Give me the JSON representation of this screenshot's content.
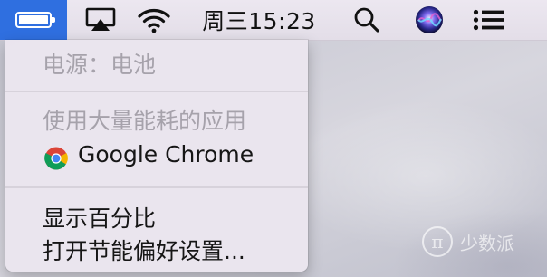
{
  "menubar": {
    "clock": "周三15:23",
    "icons": [
      "battery-icon",
      "airplay-icon",
      "wifi-icon",
      "search-icon",
      "siri-icon",
      "notification-center-icon"
    ],
    "accent_color": "#2f6fe0"
  },
  "battery_menu": {
    "power_source": "电源：电池",
    "heavy_usage_header": "使用大量能耗的应用",
    "apps": [
      {
        "name": "Google Chrome",
        "icon": "chrome-icon"
      }
    ],
    "show_percentage": "显示百分比",
    "open_preferences": "打开节能偏好设置..."
  },
  "watermark": {
    "logo_glyph": "π",
    "text": "少数派"
  }
}
